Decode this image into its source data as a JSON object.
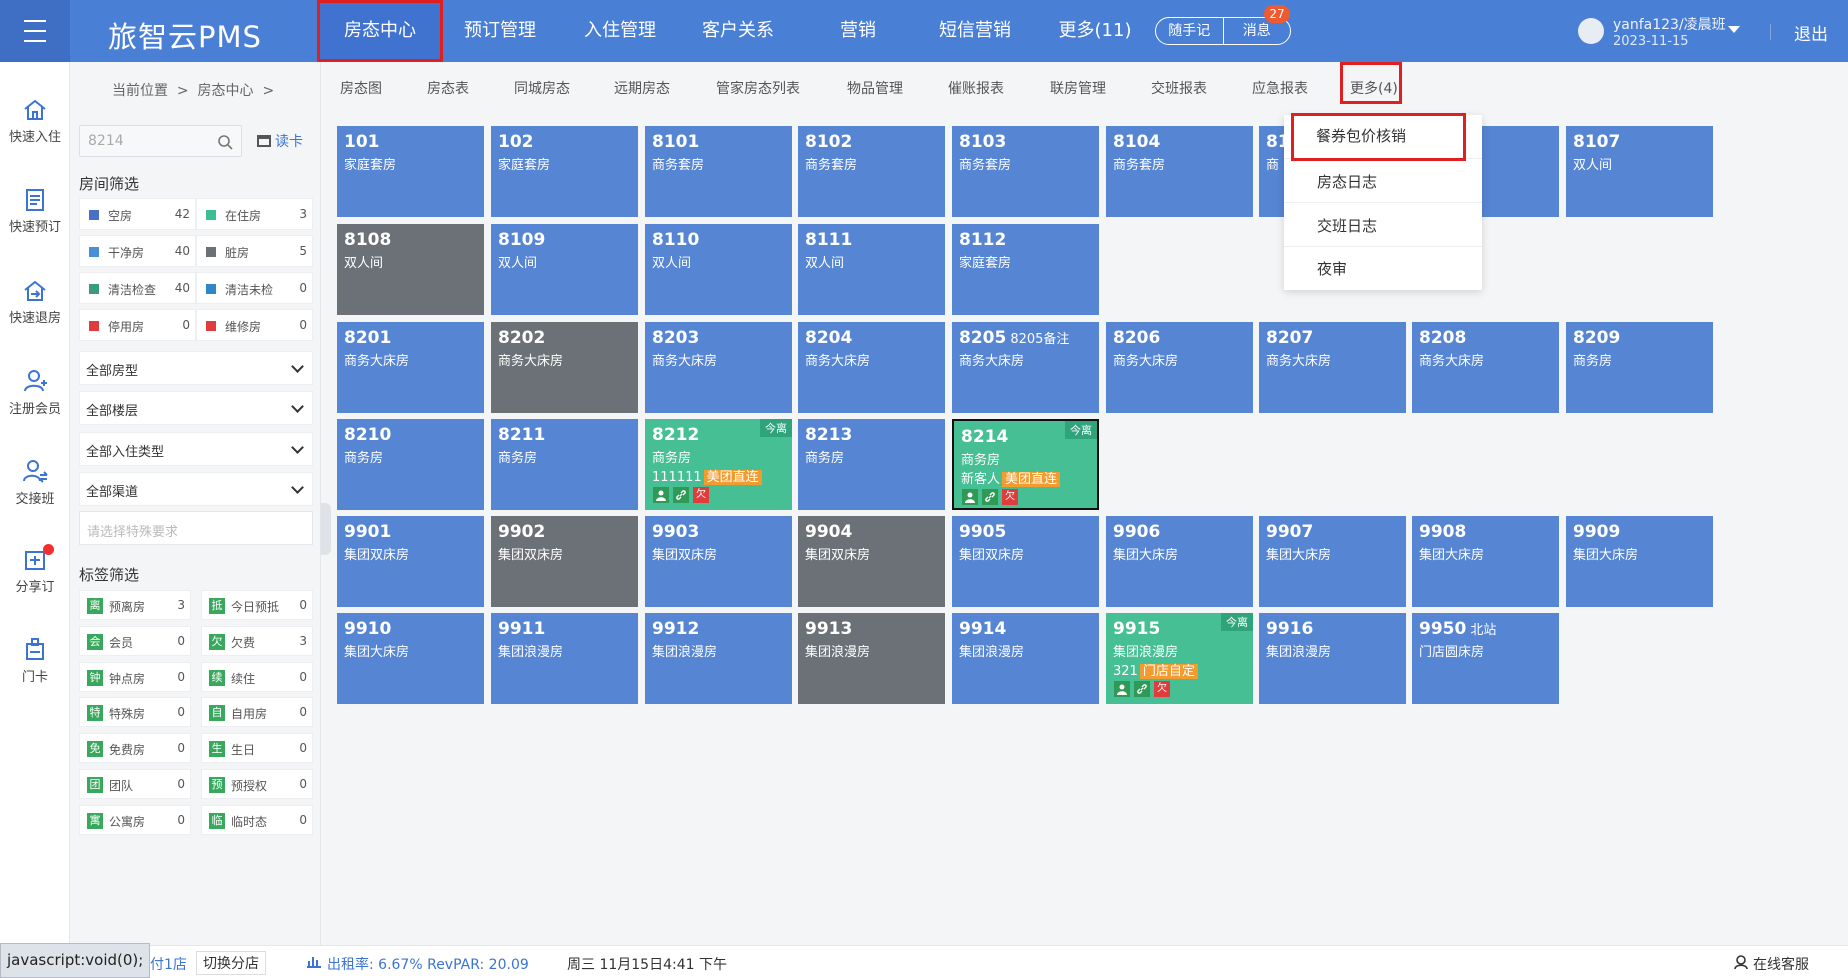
{
  "header": {
    "logo": "旅智云PMS",
    "nav": [
      {
        "label": "房态中心",
        "left": 0
      },
      {
        "label": "预订管理"
      },
      {
        "label": "入住管理"
      },
      {
        "label": "客户关系"
      },
      {
        "label": "营销"
      },
      {
        "label": "短信营销"
      },
      {
        "label": "更多(11)"
      }
    ],
    "quick_note": "随手记",
    "messages": "消息",
    "message_count": "27",
    "user_name": "yanfa123/凌晨班",
    "user_date": "2023-11-15",
    "logout": "退出"
  },
  "rail": [
    {
      "label": "快速入住",
      "icon": "home-icon"
    },
    {
      "label": "快速预订",
      "icon": "booking-icon"
    },
    {
      "label": "快速退房",
      "icon": "checkout-icon"
    },
    {
      "label": "注册会员",
      "icon": "add-member-icon"
    },
    {
      "label": "交接班",
      "icon": "shift-icon"
    },
    {
      "label": "分享订",
      "icon": "share-icon"
    },
    {
      "label": "门卡",
      "icon": "card-icon"
    }
  ],
  "breadcrumb": {
    "prefix": "当前位置",
    "current": "房态中心"
  },
  "subnav": [
    "房态图",
    "房态表",
    "同城房态",
    "远期房态",
    "管家房态列表",
    "物品管理",
    "催账报表",
    "联房管理",
    "交班报表",
    "应急报表",
    "更多(4)"
  ],
  "filters": {
    "search_value": "8214",
    "read_card": "读卡",
    "room_filter_title": "房间筛选",
    "stats": [
      {
        "label": "空房",
        "count": "42",
        "color": "#4a6fc7"
      },
      {
        "label": "在住房",
        "count": "3",
        "color": "#3cbf90"
      },
      {
        "label": "干净房",
        "count": "40",
        "color": "#4a8fd6"
      },
      {
        "label": "脏房",
        "count": "5",
        "color": "#6b7177"
      },
      {
        "label": "清洁检查",
        "count": "40",
        "color": "#3a9c7a"
      },
      {
        "label": "清洁未检",
        "count": "0",
        "color": "#2f87c9"
      },
      {
        "label": "停用房",
        "count": "0",
        "color": "#e03c3c"
      },
      {
        "label": "维修房",
        "count": "0",
        "color": "#e03c3c"
      }
    ],
    "selects": [
      "全部房型",
      "全部楼层",
      "全部入住类型",
      "全部渠道"
    ],
    "special_placeholder": "请选择特殊要求",
    "tag_filter_title": "标签筛选",
    "tags": [
      {
        "icon": "离",
        "label": "预离房",
        "count": "3"
      },
      {
        "icon": "抵",
        "label": "今日预抵",
        "count": "0"
      },
      {
        "icon": "会",
        "label": "会员",
        "count": "0"
      },
      {
        "icon": "欠",
        "label": "欠费",
        "count": "3"
      },
      {
        "icon": "钟",
        "label": "钟点房",
        "count": "0"
      },
      {
        "icon": "续",
        "label": "续住",
        "count": "0"
      },
      {
        "icon": "特",
        "label": "特殊房",
        "count": "0"
      },
      {
        "icon": "自",
        "label": "自用房",
        "count": "0"
      },
      {
        "icon": "免",
        "label": "免费房",
        "count": "0"
      },
      {
        "icon": "生",
        "label": "生日",
        "count": "0"
      },
      {
        "icon": "团",
        "label": "团队",
        "count": "0"
      },
      {
        "icon": "预",
        "label": "预授权",
        "count": "0"
      },
      {
        "icon": "寓",
        "label": "公寓房",
        "count": "0"
      },
      {
        "icon": "临",
        "label": "临时态",
        "count": "0"
      }
    ]
  },
  "rooms": [
    {
      "no": "101",
      "type": "家庭套房",
      "status": "vacant"
    },
    {
      "no": "102",
      "type": "家庭套房",
      "status": "vacant"
    },
    {
      "no": "8101",
      "type": "商务套房",
      "status": "vacant"
    },
    {
      "no": "8102",
      "type": "商务套房",
      "status": "vacant"
    },
    {
      "no": "8103",
      "type": "商务套房",
      "status": "vacant"
    },
    {
      "no": "8104",
      "type": "商务套房",
      "status": "vacant"
    },
    {
      "no": "81",
      "type": "商",
      "status": "vacant"
    },
    {
      "no": "",
      "type": "",
      "status": "vacant"
    },
    {
      "no": "8107",
      "type": "双人间",
      "status": "vacant"
    },
    {
      "no": "8108",
      "type": "双人间",
      "status": "dirty"
    },
    {
      "no": "8109",
      "type": "双人间",
      "status": "vacant"
    },
    {
      "no": "8110",
      "type": "双人间",
      "status": "vacant"
    },
    {
      "no": "8111",
      "type": "双人间",
      "status": "vacant"
    },
    {
      "no": "8112",
      "type": "家庭套房",
      "status": "vacant"
    },
    {
      "no": "8201",
      "type": "商务大床房",
      "status": "vacant"
    },
    {
      "no": "8202",
      "type": "商务大床房",
      "status": "dirty"
    },
    {
      "no": "8203",
      "type": "商务大床房",
      "status": "vacant"
    },
    {
      "no": "8204",
      "type": "商务大床房",
      "status": "vacant"
    },
    {
      "no": "8205",
      "note": "8205备注",
      "type": "商务大床房",
      "status": "vacant"
    },
    {
      "no": "8206",
      "type": "商务大床房",
      "status": "vacant"
    },
    {
      "no": "8207",
      "type": "商务大床房",
      "status": "vacant"
    },
    {
      "no": "8208",
      "type": "商务大床房",
      "status": "vacant"
    },
    {
      "no": "8209",
      "type": "商务房",
      "status": "vacant"
    },
    {
      "no": "8210",
      "type": "商务房",
      "status": "vacant"
    },
    {
      "no": "8211",
      "type": "商务房",
      "status": "vacant"
    },
    {
      "no": "8212",
      "type": "商务房",
      "status": "occupied",
      "guest": "111111",
      "channel": "美团直连",
      "leave": "今离"
    },
    {
      "no": "8213",
      "type": "商务房",
      "status": "vacant"
    },
    {
      "no": "8214",
      "type": "商务房",
      "status": "occupied",
      "guest": "新客人",
      "channel": "美团直连",
      "leave": "今离",
      "selected": true
    },
    {
      "no": "9901",
      "type": "集团双床房",
      "status": "vacant"
    },
    {
      "no": "9902",
      "type": "集团双床房",
      "status": "dirty"
    },
    {
      "no": "9903",
      "type": "集团双床房",
      "status": "vacant"
    },
    {
      "no": "9904",
      "type": "集团双床房",
      "status": "dirty"
    },
    {
      "no": "9905",
      "type": "集团双床房",
      "status": "vacant"
    },
    {
      "no": "9906",
      "type": "集团大床房",
      "status": "vacant"
    },
    {
      "no": "9907",
      "type": "集团大床房",
      "status": "vacant"
    },
    {
      "no": "9908",
      "type": "集团大床房",
      "status": "vacant"
    },
    {
      "no": "9909",
      "type": "集团大床房",
      "status": "vacant"
    },
    {
      "no": "9910",
      "type": "集团大床房",
      "status": "vacant"
    },
    {
      "no": "9911",
      "type": "集团浪漫房",
      "status": "vacant"
    },
    {
      "no": "9912",
      "type": "集团浪漫房",
      "status": "vacant"
    },
    {
      "no": "9913",
      "type": "集团浪漫房",
      "status": "dirty"
    },
    {
      "no": "9914",
      "type": "集团浪漫房",
      "status": "vacant"
    },
    {
      "no": "9915",
      "type": "集团浪漫房",
      "status": "occupied",
      "guest": "321",
      "channel": "门店自定",
      "leave": "今离"
    },
    {
      "no": "9916",
      "type": "集团浪漫房",
      "status": "vacant"
    },
    {
      "no": "9950",
      "note": "北站",
      "type": "门店圆床房",
      "status": "vacant"
    }
  ],
  "room_icons": {
    "owe": "欠"
  },
  "dropdown": [
    "餐券包价核销",
    "房态日志",
    "交班日志",
    "夜审"
  ],
  "statusbar": {
    "js_tip": "javascript:void(0);",
    "pay": "付1店",
    "switch_store": "切换分店",
    "occupancy": "出租率: 6.67%  RevPAR:  20.09",
    "datetime": "周三 11月15日4:41 下午",
    "online_service": "在线客服"
  }
}
